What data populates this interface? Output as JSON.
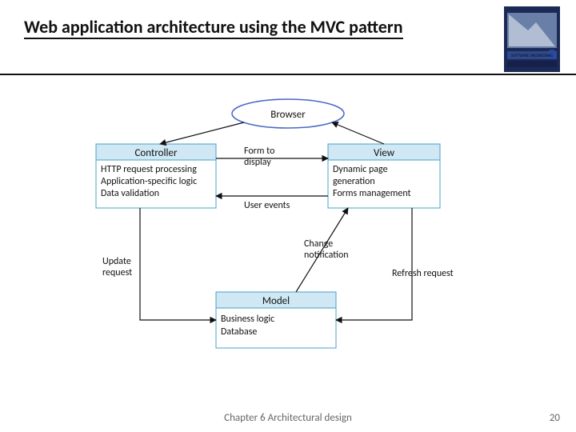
{
  "title": "Web application architecture using the MVC pattern",
  "footer": "Chapter 6 Architectural design",
  "pageNumber": "20",
  "colors": {
    "boxFill": "#cfe8f3",
    "boxStroke": "#4aa0c8",
    "ellipseStroke": "#4a66c8"
  },
  "diagram": {
    "browser": "Browser",
    "controller": {
      "title": "Controller",
      "lines": [
        "HTTP request processing",
        "Application-specific logic",
        "Data validation"
      ]
    },
    "view": {
      "title": "View",
      "lines": [
        "Dynamic page",
        "generation",
        "Forms management"
      ]
    },
    "model": {
      "title": "Model",
      "lines": [
        "Business logic",
        "Database"
      ]
    },
    "edges": {
      "formToDisplay": [
        "Form to",
        "display"
      ],
      "userEvents": "User events",
      "changeNotification": [
        "Change",
        "notification"
      ],
      "updateRequest": [
        "Update",
        "request"
      ],
      "refreshRequest": "Refresh request"
    }
  }
}
